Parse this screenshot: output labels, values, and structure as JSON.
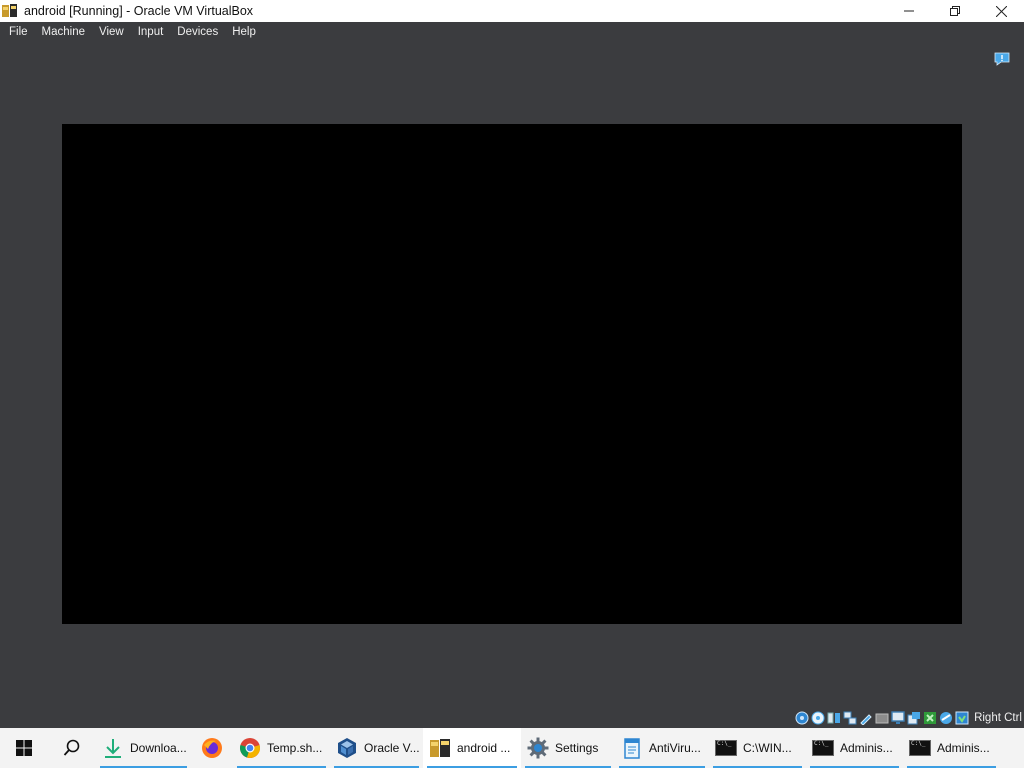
{
  "window": {
    "title": "android [Running] - Oracle VM VirtualBox",
    "controls": [
      "minimize",
      "maximize",
      "close"
    ]
  },
  "menubar": {
    "items": [
      "File",
      "Machine",
      "View",
      "Input",
      "Devices",
      "Help"
    ]
  },
  "statusbar": {
    "icons": [
      "hard-disk-icon",
      "optical-drive-icon",
      "audio-icon",
      "network-icon",
      "usb-icon",
      "shared-folders-icon",
      "display-icon",
      "video-capture-icon",
      "mouse-integration-icon",
      "cpu-icon",
      "keyboard-icon"
    ],
    "host_key": "Right Ctrl"
  },
  "taskbar": {
    "items": [
      {
        "name": "downloads",
        "label": "Downloa...",
        "icon": "download-arrow-icon",
        "open": true
      },
      {
        "name": "firefox",
        "label": "",
        "icon": "firefox-icon",
        "open": false
      },
      {
        "name": "chrome",
        "label": "Temp.sh...",
        "icon": "chrome-icon",
        "open": true
      },
      {
        "name": "virtualbox-manager",
        "label": "Oracle V...",
        "icon": "virtualbox-icon",
        "open": true
      },
      {
        "name": "android-vm",
        "label": "android ...",
        "icon": "virtualbox-vm-icon",
        "open": true,
        "active": true
      },
      {
        "name": "settings",
        "label": "Settings",
        "icon": "gear-icon",
        "open": true
      },
      {
        "name": "antivirus-notepad",
        "label": "AntiViru...",
        "icon": "notepad-icon",
        "open": true
      },
      {
        "name": "cmd-windows",
        "label": "C:\\WIN...",
        "icon": "cmd-icon",
        "open": true
      },
      {
        "name": "admin-cmd-1",
        "label": "Adminis...",
        "icon": "cmd-icon",
        "open": true
      },
      {
        "name": "admin-cmd-2",
        "label": "Adminis...",
        "icon": "cmd-icon",
        "open": true
      }
    ]
  },
  "colors": {
    "window_bg": "#3b3c3f",
    "vm_screen": "#000000",
    "taskbar_bg": "#f3f3f3",
    "accent": "#3c9ee2"
  }
}
